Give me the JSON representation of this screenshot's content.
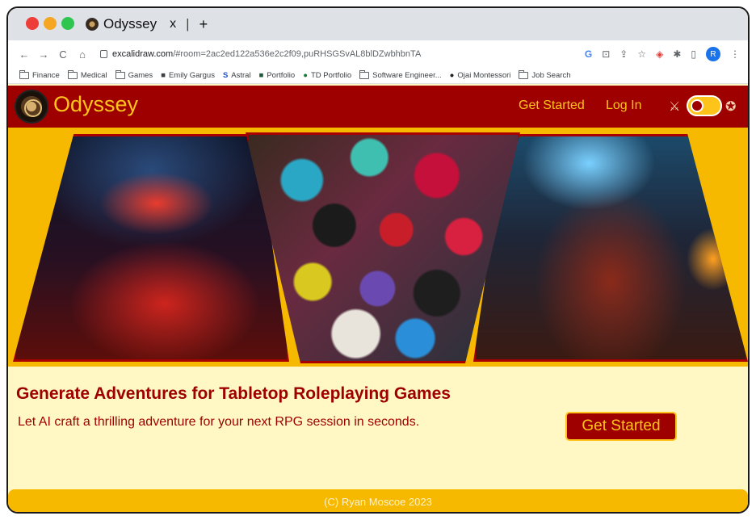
{
  "browser": {
    "tab": {
      "title": "Odyssey",
      "close": "x",
      "separator": "|",
      "new_tab": "+"
    },
    "toolbar": {
      "back": "←",
      "forward": "→",
      "reload": "C",
      "home": "⌂",
      "url_host": "excalidraw.com",
      "url_rest": "/#room=2ac2ed122a536e2c2f09,puRHSGSvAL8blDZwbhbnTA",
      "profile_initial": "R"
    },
    "bookmarks": [
      {
        "label": "Finance",
        "icon": "folder-icon"
      },
      {
        "label": "Medical",
        "icon": "folder-icon"
      },
      {
        "label": "Games",
        "icon": "folder-icon"
      },
      {
        "label": "Emily Gargus",
        "icon": "cube-icon"
      },
      {
        "label": "Astral",
        "icon": "s-logo-icon"
      },
      {
        "label": "Portfolio",
        "icon": "square-icon"
      },
      {
        "label": "TD Portfolio",
        "icon": "circle-icon"
      },
      {
        "label": "Software Engineer...",
        "icon": "folder-icon"
      },
      {
        "label": "Ojai Montessori",
        "icon": "circle-icon"
      },
      {
        "label": "Job Search",
        "icon": "folder-icon"
      }
    ]
  },
  "app": {
    "brand": "Odyssey",
    "nav": {
      "get_started": "Get Started",
      "log_in": "Log In"
    },
    "theme_toggle": {
      "left_icon": "sword-icon",
      "right_icon": "planet-icon",
      "state": "off"
    },
    "hero_images": [
      "dragon-scene-image",
      "dice-pile-image",
      "dwarf-warriors-image"
    ],
    "headline": "Generate Adventures for Tabletop Roleplaying Games",
    "subheadline": "Let AI craft a thrilling adventure for your next RPG session in seconds.",
    "cta": "Get Started",
    "footer": "(C) Ryan Moscoe 2023",
    "colors": {
      "primary": "#9e0000",
      "accent": "#ffc41a",
      "hero_bg": "#f7b800",
      "content_bg": "#fff8c4"
    }
  }
}
